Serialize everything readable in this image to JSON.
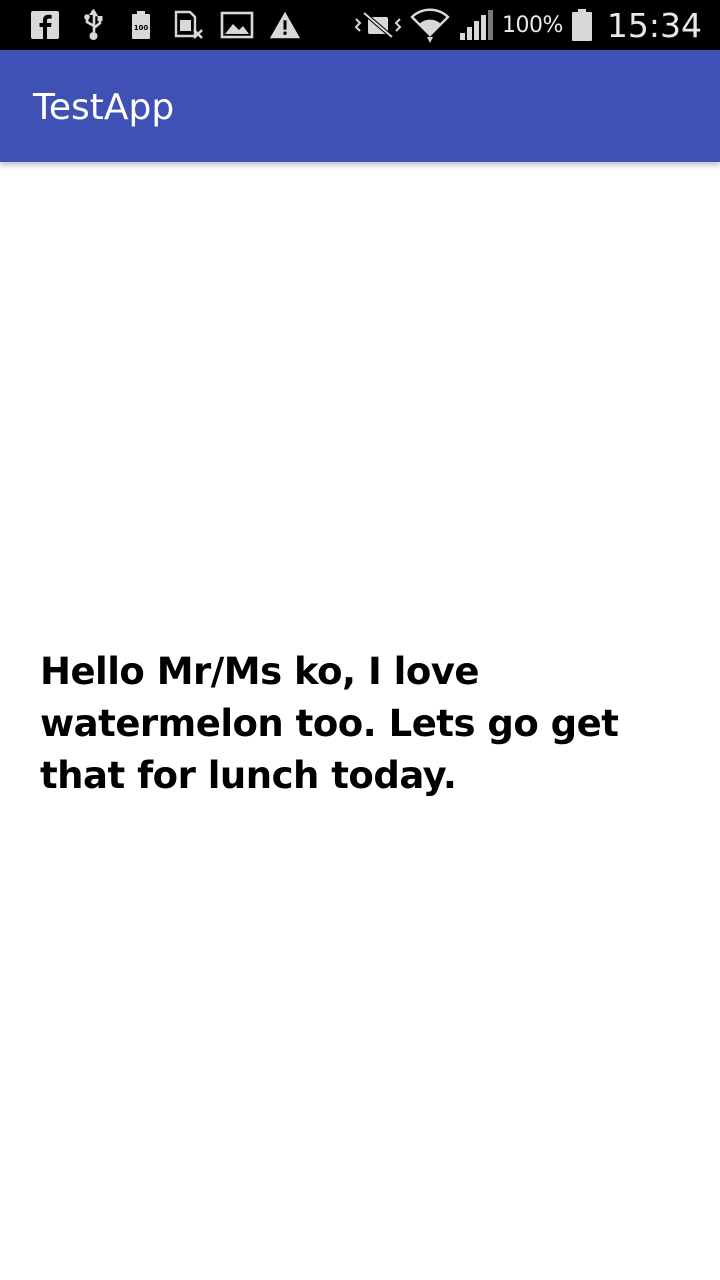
{
  "status_bar": {
    "notification_icons": [
      "facebook-icon",
      "usb-icon",
      "battery-100-icon",
      "sim-card-icon",
      "image-icon",
      "warning-icon"
    ],
    "system_icons": [
      "mute-icon",
      "wifi-icon",
      "signal-icon"
    ],
    "battery_percent": "100%",
    "time": "15:34"
  },
  "app_bar": {
    "title": "TestApp",
    "color": "#3F51B5"
  },
  "main": {
    "message": "Hello Mr/Ms ko, I love watermelon too. Lets go get that for lunch today."
  }
}
